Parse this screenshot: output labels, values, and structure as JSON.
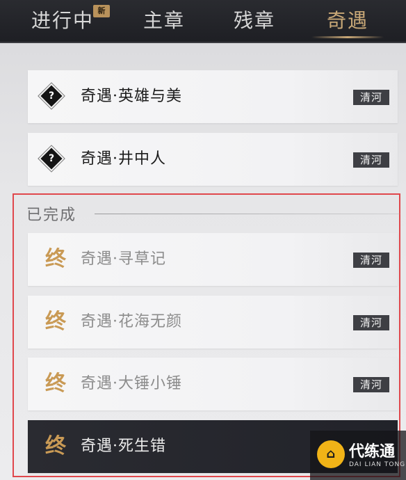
{
  "tabs": [
    {
      "label": "进行中",
      "badge": "新",
      "active": false
    },
    {
      "label": "主章",
      "active": false
    },
    {
      "label": "残章",
      "active": false
    },
    {
      "label": "奇遇",
      "active": true
    }
  ],
  "in_progress": [
    {
      "title": "奇遇·英雄与美",
      "location": "清河",
      "icon": "question-diamond-icon",
      "icon_glyph": "?"
    },
    {
      "title": "奇遇·井中人",
      "location": "清河",
      "icon": "question-diamond-icon",
      "icon_glyph": "?"
    }
  ],
  "completed": {
    "title": "已完成",
    "icon_glyph": "终",
    "items": [
      {
        "title": "奇遇·寻草记",
        "location": "清河"
      },
      {
        "title": "奇遇·花海无颜",
        "location": "清河"
      },
      {
        "title": "奇遇·大锤小锤",
        "location": "清河"
      },
      {
        "title": "奇遇·死生错",
        "location": "",
        "selected": true
      }
    ]
  },
  "watermark": {
    "name": "代练通",
    "sub": "DAI LIAN TONG",
    "glyph": "⌂"
  },
  "colors": {
    "accent": "#c9a877",
    "highlight_border": "#e0474c",
    "tag_bg": "#3e3f44"
  }
}
